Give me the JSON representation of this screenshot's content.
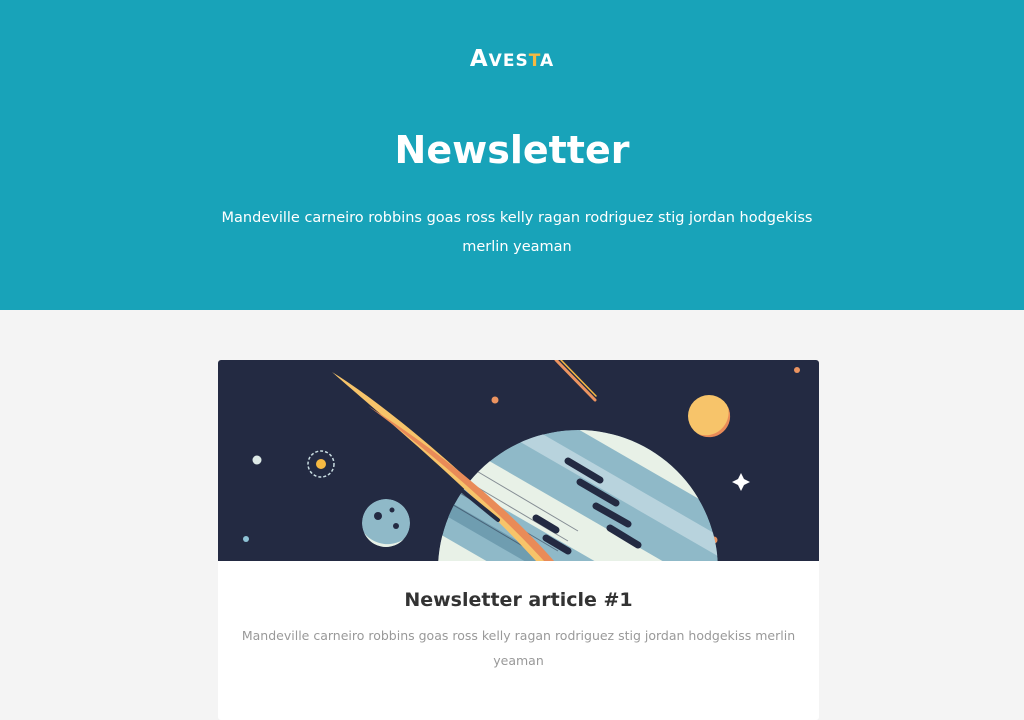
{
  "brand": {
    "logo_letters": [
      "A",
      "VES",
      "T",
      "A"
    ],
    "accent_color": "#f5b942",
    "hero_color": "#18a3b9"
  },
  "hero": {
    "title": "Newsletter",
    "text": "Mandeville carneiro robbins goas ross kelly ragan rodriguez stig jordan hodgekiss merlin yeaman"
  },
  "article": {
    "image_icon": "space-planet-illustration",
    "title": "Newsletter article #1",
    "text": "Mandeville carneiro robbins goas ross kelly ragan rodriguez stig jordan hodgekiss merlin yeaman"
  }
}
